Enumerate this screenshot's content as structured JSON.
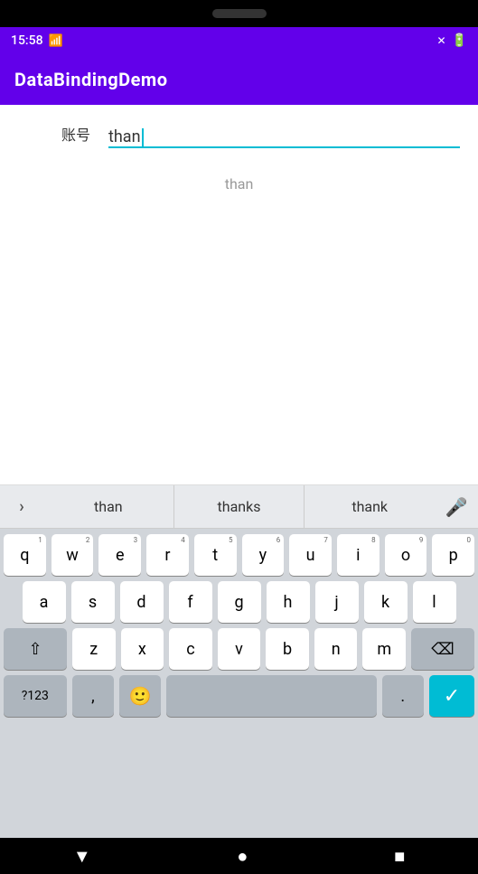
{
  "phone": {
    "status_time": "15:58",
    "battery_icon": "🔋",
    "signal_icon": "📶"
  },
  "app": {
    "title": "DataBindingDemo"
  },
  "form": {
    "account_label": "账号",
    "input_value": "than",
    "suggestion_text": "than"
  },
  "suggestions": {
    "expand_icon": "›",
    "items": [
      "than",
      "thanks",
      "thank"
    ],
    "mic_icon": "🎤"
  },
  "keyboard": {
    "row1": [
      {
        "label": "q",
        "hint": "1"
      },
      {
        "label": "w",
        "hint": "2"
      },
      {
        "label": "e",
        "hint": "3"
      },
      {
        "label": "r",
        "hint": "4"
      },
      {
        "label": "t",
        "hint": "5"
      },
      {
        "label": "y",
        "hint": "6"
      },
      {
        "label": "u",
        "hint": "7"
      },
      {
        "label": "i",
        "hint": "8"
      },
      {
        "label": "o",
        "hint": "9"
      },
      {
        "label": "p",
        "hint": "0"
      }
    ],
    "row2": [
      {
        "label": "a"
      },
      {
        "label": "s"
      },
      {
        "label": "d"
      },
      {
        "label": "f"
      },
      {
        "label": "g"
      },
      {
        "label": "h"
      },
      {
        "label": "j"
      },
      {
        "label": "k"
      },
      {
        "label": "l"
      }
    ],
    "row3_shift": "⇧",
    "row3": [
      {
        "label": "z"
      },
      {
        "label": "x"
      },
      {
        "label": "c"
      },
      {
        "label": "v"
      },
      {
        "label": "b"
      },
      {
        "label": "n"
      },
      {
        "label": "m"
      }
    ],
    "row3_delete": "⌫",
    "row4_symbols": "?123",
    "row4_comma": ",",
    "row4_emoji": "🙂",
    "row4_space": "",
    "row4_period": ".",
    "row4_done": "✓"
  },
  "nav": {
    "back_icon": "▼",
    "home_icon": "●",
    "recent_icon": "■"
  }
}
